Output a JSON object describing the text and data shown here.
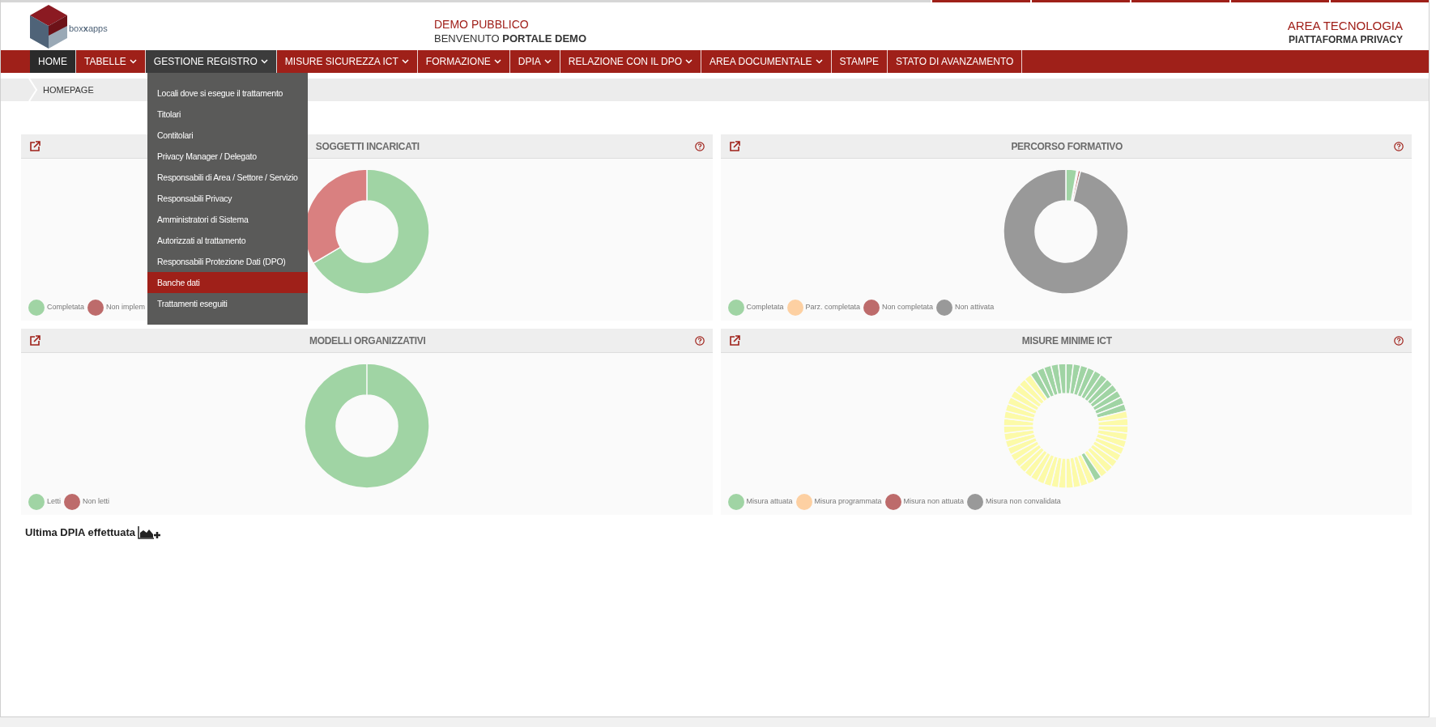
{
  "header": {
    "logo_text": "box**x**apps",
    "title": "DEMO PUBBLICO",
    "welcome": "BENVENUTO **PORTALE DEMO**",
    "area": "AREA TECNOLOGIA",
    "platform": "PIATTAFORMA PRIVACY"
  },
  "nav": [
    {
      "label": "HOME",
      "dropdown": false,
      "selected": true,
      "expanded": false
    },
    {
      "label": "TABELLE",
      "dropdown": true,
      "selected": false,
      "expanded": false
    },
    {
      "label": "GESTIONE REGISTRO",
      "dropdown": true,
      "selected": false,
      "expanded": true,
      "menu": [
        {
          "label": "Locali dove si esegue il trattamento",
          "selected": false
        },
        {
          "label": "Titolari",
          "selected": false
        },
        {
          "label": "Contitolari",
          "selected": false
        },
        {
          "label": "Privacy Manager / Delegato",
          "selected": false
        },
        {
          "label": "Responsabili di Area / Settore / Servizio",
          "selected": false
        },
        {
          "label": "Responsabili Privacy",
          "selected": false
        },
        {
          "label": "Amministratori di Sistema",
          "selected": false
        },
        {
          "label": "Autorizzati al trattamento",
          "selected": false
        },
        {
          "label": "Responsabili Protezione Dati (DPO)",
          "selected": false
        },
        {
          "label": "Banche dati",
          "selected": true
        },
        {
          "label": "Trattamenti eseguiti",
          "selected": false
        }
      ]
    },
    {
      "label": "MISURE SICUREZZA ICT",
      "dropdown": true,
      "selected": false,
      "expanded": false
    },
    {
      "label": "FORMAZIONE",
      "dropdown": true,
      "selected": false,
      "expanded": false
    },
    {
      "label": "DPIA",
      "dropdown": true,
      "selected": false,
      "expanded": false
    },
    {
      "label": "RELAZIONE CON IL DPO",
      "dropdown": true,
      "selected": false,
      "expanded": false
    },
    {
      "label": "AREA DOCUMENTALE",
      "dropdown": true,
      "selected": false,
      "expanded": false
    },
    {
      "label": "STAMPE",
      "dropdown": false,
      "selected": false,
      "expanded": false
    },
    {
      "label": "STATO DI AVANZAMENTO",
      "dropdown": false,
      "selected": false,
      "expanded": false
    }
  ],
  "breadcrumb": [
    "HOMEPAGE"
  ],
  "panels": [
    {
      "title": "SOGGETTI INCARICATI",
      "kind": "donut",
      "legend": [
        {
          "label": "Completata",
          "color": "#a0d4a4"
        },
        {
          "label": "Non implem",
          "color": "#bd6b6b"
        }
      ]
    },
    {
      "title": "PERCORSO FORMATIVO",
      "kind": "donut",
      "legend": [
        {
          "label": "Completata",
          "color": "#a0d4a4"
        },
        {
          "label": "Parz. completata",
          "color": "#fdd0a2"
        },
        {
          "label": "Non completata",
          "color": "#bd6b6b"
        },
        {
          "label": "Non attivata",
          "color": "#999999"
        }
      ]
    },
    {
      "title": "MODELLI ORGANIZZATIVI",
      "kind": "donut",
      "legend": [
        {
          "label": "Letti",
          "color": "#a0d4a4"
        },
        {
          "label": "Non letti",
          "color": "#bd6b6b"
        }
      ]
    },
    {
      "title": "MISURE MINIME ICT",
      "kind": "segments",
      "legend": [
        {
          "label": "Misura attuata",
          "color": "#a0d4a4"
        },
        {
          "label": "Misura programmata",
          "color": "#fdd0a2"
        },
        {
          "label": "Misura non attuata",
          "color": "#bd6b6b"
        },
        {
          "label": "Misura non convalidata",
          "color": "#999999"
        }
      ]
    }
  ],
  "footer_note": "Ultima DPIA effettuata"
}
